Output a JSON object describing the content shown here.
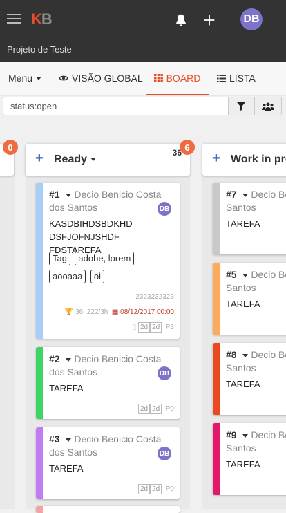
{
  "header": {
    "logo_k": "K",
    "logo_b": "B",
    "avatar_initials": "DB",
    "project_name": "Projeto de Teste"
  },
  "nav": {
    "menu_label": "Menu",
    "global_label": "VISÃO GLOBAL",
    "board_label": "BOARD",
    "list_label": "LISTA",
    "active": "BOARD",
    "accent_color": "#e84e2b"
  },
  "filter": {
    "value": "status:open"
  },
  "columns": [
    {
      "badge": "0"
    },
    {
      "name": "Ready",
      "count": "36",
      "badge": "6"
    },
    {
      "name": "Work in progress"
    }
  ],
  "cards": {
    "c1": {
      "number": "#1",
      "assignee": "Decio Benicio Costa dos Santos",
      "avatar": "DB",
      "desc": "KASDBIHDSBDKHD DSFJOFNJSHDF FDSTAREFA",
      "tags": [
        "Tag",
        "adobe, lorem",
        "aooaaa",
        "oi"
      ],
      "ref": "2323232323",
      "score": "36",
      "time": "222/3h",
      "due": "08/12/2017 00:00",
      "est1": "2d",
      "est2": "2d",
      "priority": "P3",
      "color": "#a9cdf7"
    },
    "c2": {
      "number": "#2",
      "assignee": "Decio Benicio Costa dos Santos",
      "avatar": "DB",
      "desc": "TAREFA",
      "est1": "2d",
      "est2": "2d",
      "priority": "P0",
      "color": "#3fd465"
    },
    "c3": {
      "number": "#3",
      "assignee": "Decio Benicio Costa dos Santos",
      "avatar": "DB",
      "desc": "TAREFA",
      "est1": "2d",
      "est2": "2d",
      "priority": "P0",
      "color": "#c07df2"
    },
    "c7": {
      "number": "#7",
      "assignee": "Decio Benicio Costa dos Santos",
      "desc": "TAREFA",
      "color": "#c8c8c8"
    },
    "c5": {
      "number": "#5",
      "assignee": "Decio Benicio Costa dos Santos",
      "desc": "TAREFA",
      "color": "#fdaa5c"
    },
    "c8": {
      "number": "#8",
      "assignee": "Decio Benicio Costa dos Santos",
      "desc": "TAREFA",
      "color": "#ea4a1f"
    },
    "c9": {
      "number": "#9",
      "assignee": "Decio Benicio Costa dos Santos",
      "desc": "TAREFA",
      "color": "#e5176b"
    }
  }
}
